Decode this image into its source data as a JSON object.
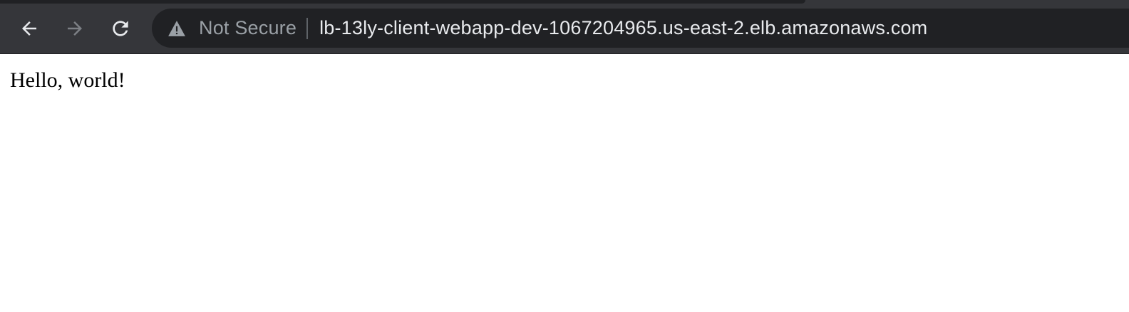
{
  "browser": {
    "security_label": "Not Secure",
    "url": "lb-13ly-client-webapp-dev-1067204965.us-east-2.elb.amazonaws.com",
    "icons": {
      "back": "arrow-left-icon",
      "forward": "arrow-right-icon",
      "reload": "reload-icon",
      "security": "warning-triangle-icon"
    },
    "forward_enabled": false
  },
  "page": {
    "body_text": "Hello, world!"
  },
  "colors": {
    "toolbar_bg": "#35363a",
    "omnibox_bg": "#202124",
    "url_text": "#e8eaed",
    "muted_text": "#9aa0a6",
    "page_bg": "#ffffff"
  }
}
